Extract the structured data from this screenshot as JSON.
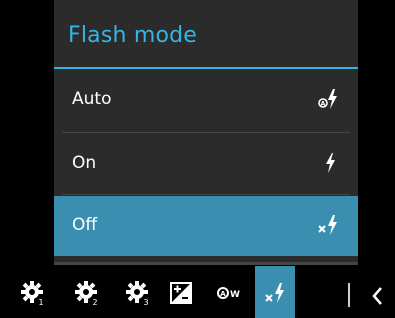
{
  "popup": {
    "title": "Flash mode",
    "options": [
      {
        "label": "Auto",
        "icon": "flash-auto-icon",
        "selected": false
      },
      {
        "label": "On",
        "icon": "flash-on-icon",
        "selected": false
      },
      {
        "label": "Off",
        "icon": "flash-off-icon",
        "selected": true
      }
    ]
  },
  "settings_bar": {
    "items": [
      {
        "icon": "custom-setting-1-icon"
      },
      {
        "icon": "custom-setting-2-icon"
      },
      {
        "icon": "custom-setting-3-icon"
      },
      {
        "icon": "exposure-compensation-icon"
      },
      {
        "icon": "white-balance-auto-icon"
      },
      {
        "icon": "flash-off-icon",
        "active": true
      }
    ],
    "back_icon": "chevron-left-icon"
  },
  "colors": {
    "accent": "#33b5e5",
    "selected": "#3a8fb0",
    "popup_bg": "#2b2b2b",
    "background": "#000000"
  }
}
